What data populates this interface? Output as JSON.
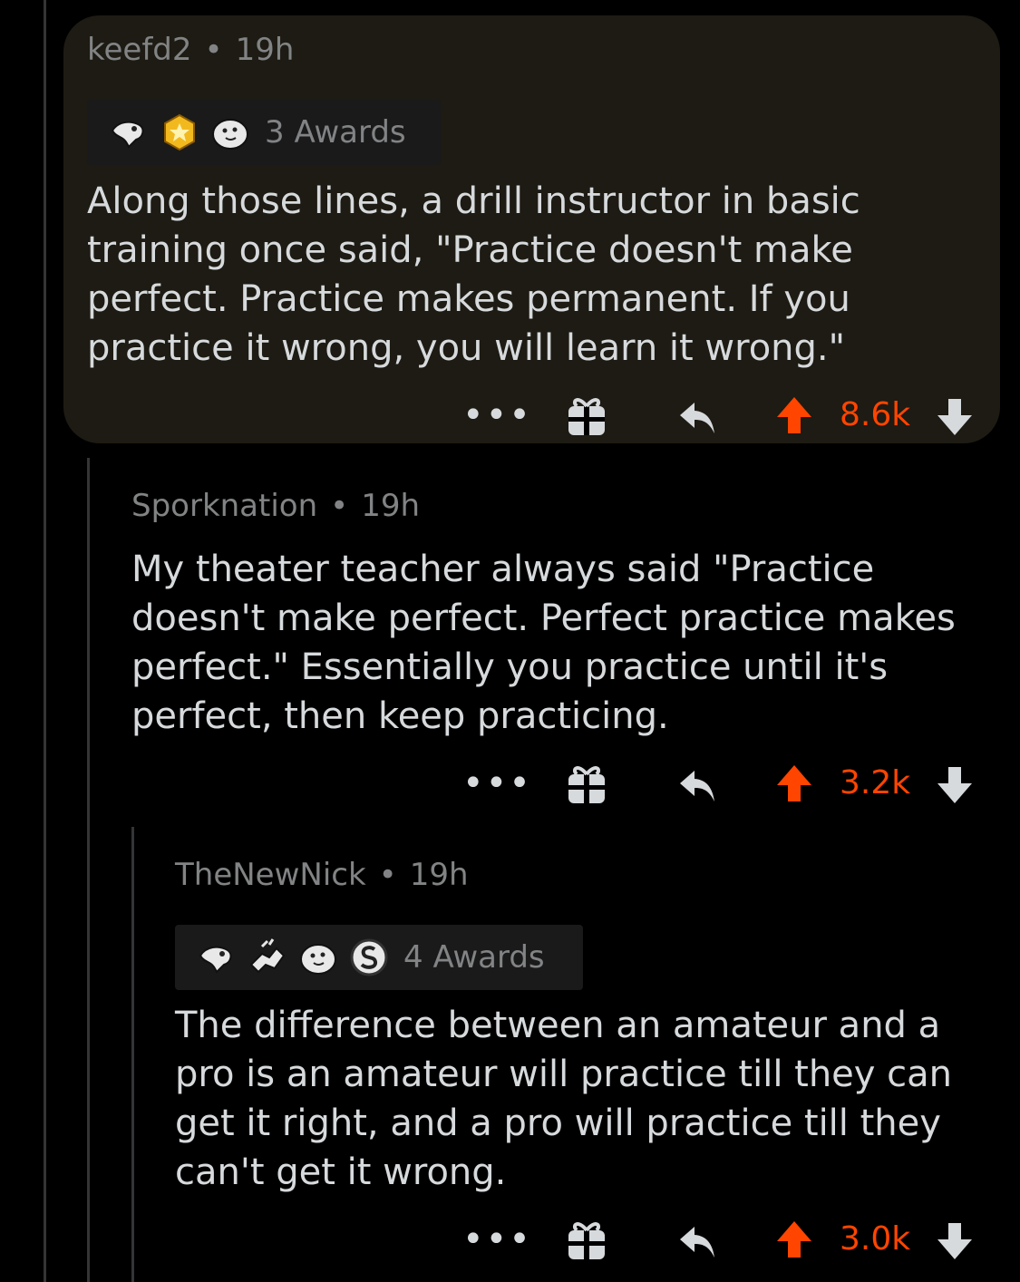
{
  "comments": [
    {
      "username": "keefd2",
      "separator": "•",
      "time": "19h",
      "awards_label": "3 Awards",
      "award_icons": [
        "hug-award-icon",
        "gold-badge-award-icon",
        "seal-award-icon"
      ],
      "body": "Along those lines, a drill instructor in basic training once said, \"Practice doesn't make perfect. Practice makes permanent. If you practice it wrong, you will learn it wrong.\"",
      "score": "8.6k",
      "more_label": "•••"
    },
    {
      "username": "Sporknation",
      "separator": "•",
      "time": "19h",
      "body": "My theater teacher always said \"Practice doesn't make perfect.  Perfect practice makes perfect.\"  Essentially you practice until it's perfect, then keep practicing.",
      "score": "3.2k",
      "more_label": "•••"
    },
    {
      "username": "TheNewNick",
      "separator": "•",
      "time": "19h",
      "awards_label": "4 Awards",
      "award_icons": [
        "hug-award-icon",
        "handshake-award-icon",
        "seal-award-icon",
        "silver-coin-award-icon"
      ],
      "body": "The difference between an amateur and a pro is an amateur will practice till they can get it right, and a pro will practice till they can't get it wrong.",
      "score": "3.0k",
      "more_label": "•••"
    }
  ],
  "colors": {
    "upvote_active": "#ff4500",
    "highlight_bg": "#1d1b13",
    "text": "#d7dadc",
    "meta": "#818384"
  }
}
